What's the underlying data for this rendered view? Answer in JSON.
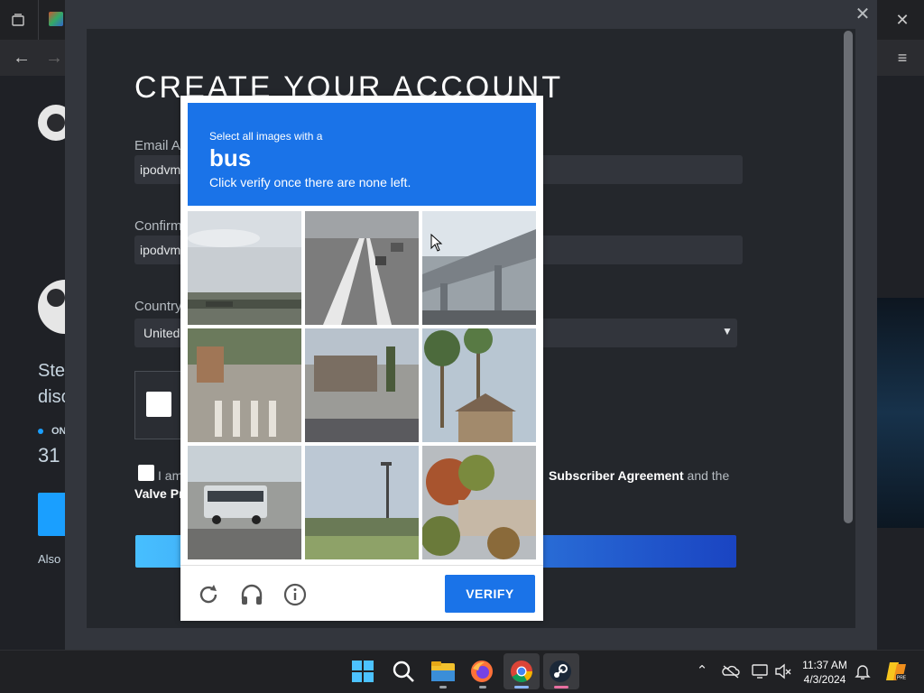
{
  "browser": {
    "back_icon": "arrow-left-icon",
    "forward_icon": "arrow-right-icon",
    "close_icon": "close-icon",
    "menu_icon": "hamburger-menu-icon"
  },
  "background": {
    "text_ste": "Ste",
    "text_disc": "disc",
    "online_label": "ON",
    "count_partial": "31",
    "also_partial": "Also"
  },
  "signup": {
    "title": "CREATE YOUR ACCOUNT",
    "email_label": "Email Ac",
    "email_value": "ipodvm",
    "confirm_label": "Confirm",
    "confirm_value": "ipodvm",
    "country_label": "Country",
    "country_value": "United",
    "agree_prefix": "I am",
    "agree_link1": "Subscriber Agreement",
    "agree_mid": " and the",
    "agree_link2": "Valve Pr"
  },
  "captcha": {
    "prompt_line1": "Select all images with a",
    "target": "bus",
    "prompt_line3": "Click verify once there are none left.",
    "verify_label": "VERIFY",
    "tiles": [
      "water-skyline",
      "highway-lanes",
      "overpass",
      "crosswalk-plaza",
      "parking-lot-buildings",
      "palm-trees-houses",
      "bus-on-road",
      "street-lamp-lawn",
      "autumn-shrubs-wall"
    ],
    "icons": [
      "refresh-icon",
      "headphones-icon",
      "info-icon"
    ]
  },
  "taskbar": {
    "time": "11:37 AM",
    "date": "4/3/2024",
    "apps": [
      "start-icon",
      "search-icon",
      "file-explorer-icon",
      "firefox-icon",
      "chrome-icon",
      "steam-icon"
    ],
    "tray_icons": [
      "chevron-up-icon",
      "onedrive-icon",
      "network-icon",
      "volume-muted-icon",
      "notifications-icon",
      "copilot-icon"
    ]
  },
  "colors": {
    "captcha_blue": "#1a73e8",
    "steam_modal": "#24272c",
    "continue_gradient_start": "#47bfff",
    "continue_gradient_end": "#1a44c2"
  }
}
